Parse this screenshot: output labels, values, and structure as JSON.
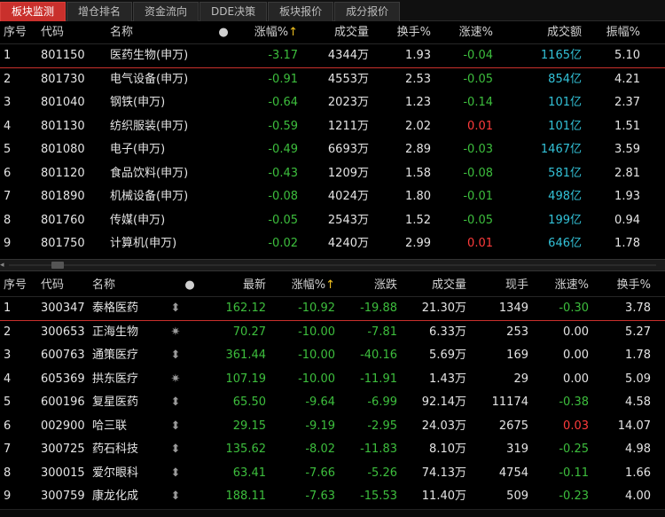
{
  "tabs": [
    "板块监测",
    "增仓排名",
    "资金流向",
    "DDE决策",
    "板块报价",
    "成分报价"
  ],
  "sector_table": {
    "headers": {
      "seq": "序号",
      "code": "代码",
      "name": "名称",
      "dot": "●",
      "change_pct": "涨幅%",
      "arrow": "↑",
      "volume": "成交量",
      "turnover": "换手%",
      "speed": "涨速%",
      "amount": "成交额",
      "amplitude": "振幅%"
    },
    "rows": [
      {
        "seq": "1",
        "code": "801150",
        "name": "医药生物(申万)",
        "change_pct": "-3.17",
        "volume": "4344万",
        "turnover": "1.93",
        "speed": "-0.04",
        "amount": "1165亿",
        "amplitude": "5.10"
      },
      {
        "seq": "2",
        "code": "801730",
        "name": "电气设备(申万)",
        "change_pct": "-0.91",
        "volume": "4553万",
        "turnover": "2.53",
        "speed": "-0.05",
        "amount": "854亿",
        "amplitude": "4.21"
      },
      {
        "seq": "3",
        "code": "801040",
        "name": "钢铁(申万)",
        "change_pct": "-0.64",
        "volume": "2023万",
        "turnover": "1.23",
        "speed": "-0.14",
        "amount": "101亿",
        "amplitude": "2.37"
      },
      {
        "seq": "4",
        "code": "801130",
        "name": "纺织服装(申万)",
        "change_pct": "-0.59",
        "volume": "1211万",
        "turnover": "2.02",
        "speed": "0.01",
        "amount": "101亿",
        "amplitude": "1.51"
      },
      {
        "seq": "5",
        "code": "801080",
        "name": "电子(申万)",
        "change_pct": "-0.49",
        "volume": "6693万",
        "turnover": "2.89",
        "speed": "-0.03",
        "amount": "1467亿",
        "amplitude": "3.59"
      },
      {
        "seq": "6",
        "code": "801120",
        "name": "食品饮料(申万)",
        "change_pct": "-0.43",
        "volume": "1209万",
        "turnover": "1.58",
        "speed": "-0.08",
        "amount": "581亿",
        "amplitude": "2.81"
      },
      {
        "seq": "7",
        "code": "801890",
        "name": "机械设备(申万)",
        "change_pct": "-0.08",
        "volume": "4024万",
        "turnover": "1.80",
        "speed": "-0.01",
        "amount": "498亿",
        "amplitude": "1.93"
      },
      {
        "seq": "8",
        "code": "801760",
        "name": "传媒(申万)",
        "change_pct": "-0.05",
        "volume": "2543万",
        "turnover": "1.52",
        "speed": "-0.05",
        "amount": "199亿",
        "amplitude": "0.94"
      },
      {
        "seq": "9",
        "code": "801750",
        "name": "计算机(申万)",
        "change_pct": "-0.02",
        "volume": "4240万",
        "turnover": "2.99",
        "speed": "0.01",
        "amount": "646亿",
        "amplitude": "1.78"
      }
    ]
  },
  "scroll": {
    "left_arrow": "◂",
    "thumb": "III"
  },
  "stock_table": {
    "headers": {
      "seq": "序号",
      "code": "代码",
      "name": "名称",
      "dot": "●",
      "last": "最新",
      "change_pct": "涨幅%",
      "arrow": "↑",
      "change": "涨跌",
      "volume": "成交量",
      "hand": "现手",
      "speed": "涨速%",
      "turnover": "换手%"
    },
    "rows": [
      {
        "seq": "1",
        "code": "300347",
        "name": "泰格医药",
        "mark": "⬍",
        "last": "162.12",
        "change_pct": "-10.92",
        "change": "-19.88",
        "volume": "21.30万",
        "hand": "1349",
        "speed": "-0.30",
        "turnover": "3.78"
      },
      {
        "seq": "2",
        "code": "300653",
        "name": "正海生物",
        "mark": "✷",
        "last": "70.27",
        "change_pct": "-10.00",
        "change": "-7.81",
        "volume": "6.33万",
        "hand": "253",
        "speed": "0.00",
        "turnover": "5.27"
      },
      {
        "seq": "3",
        "code": "600763",
        "name": "通策医疗",
        "mark": "⬍",
        "last": "361.44",
        "change_pct": "-10.00",
        "change": "-40.16",
        "volume": "5.69万",
        "hand": "169",
        "speed": "0.00",
        "turnover": "1.78"
      },
      {
        "seq": "4",
        "code": "605369",
        "name": "拱东医疗",
        "mark": "✷",
        "last": "107.19",
        "change_pct": "-10.00",
        "change": "-11.91",
        "volume": "1.43万",
        "hand": "29",
        "speed": "0.00",
        "turnover": "5.09"
      },
      {
        "seq": "5",
        "code": "600196",
        "name": "复星医药",
        "mark": "⬍",
        "last": "65.50",
        "change_pct": "-9.64",
        "change": "-6.99",
        "volume": "92.14万",
        "hand": "11174",
        "speed": "-0.38",
        "turnover": "4.58"
      },
      {
        "seq": "6",
        "code": "002900",
        "name": "哈三联",
        "mark": "⬍",
        "last": "29.15",
        "change_pct": "-9.19",
        "change": "-2.95",
        "volume": "24.03万",
        "hand": "2675",
        "speed": "0.03",
        "turnover": "14.07"
      },
      {
        "seq": "7",
        "code": "300725",
        "name": "药石科技",
        "mark": "⬍",
        "last": "135.62",
        "change_pct": "-8.02",
        "change": "-11.83",
        "volume": "8.10万",
        "hand": "319",
        "speed": "-0.25",
        "turnover": "4.98"
      },
      {
        "seq": "8",
        "code": "300015",
        "name": "爱尔眼科",
        "mark": "⬍",
        "last": "63.41",
        "change_pct": "-7.66",
        "change": "-5.26",
        "volume": "74.13万",
        "hand": "4754",
        "speed": "-0.11",
        "turnover": "1.66"
      },
      {
        "seq": "9",
        "code": "300759",
        "name": "康龙化成",
        "mark": "⬍",
        "last": "188.11",
        "change_pct": "-7.63",
        "change": "-15.53",
        "volume": "11.40万",
        "hand": "509",
        "speed": "-0.23",
        "turnover": "4.00"
      }
    ]
  },
  "colors": {
    "down": "#3dbe3d",
    "up": "#ff3b3b",
    "amount": "#33c2d8",
    "active_tab": "#c9302c",
    "background": "#000000"
  }
}
